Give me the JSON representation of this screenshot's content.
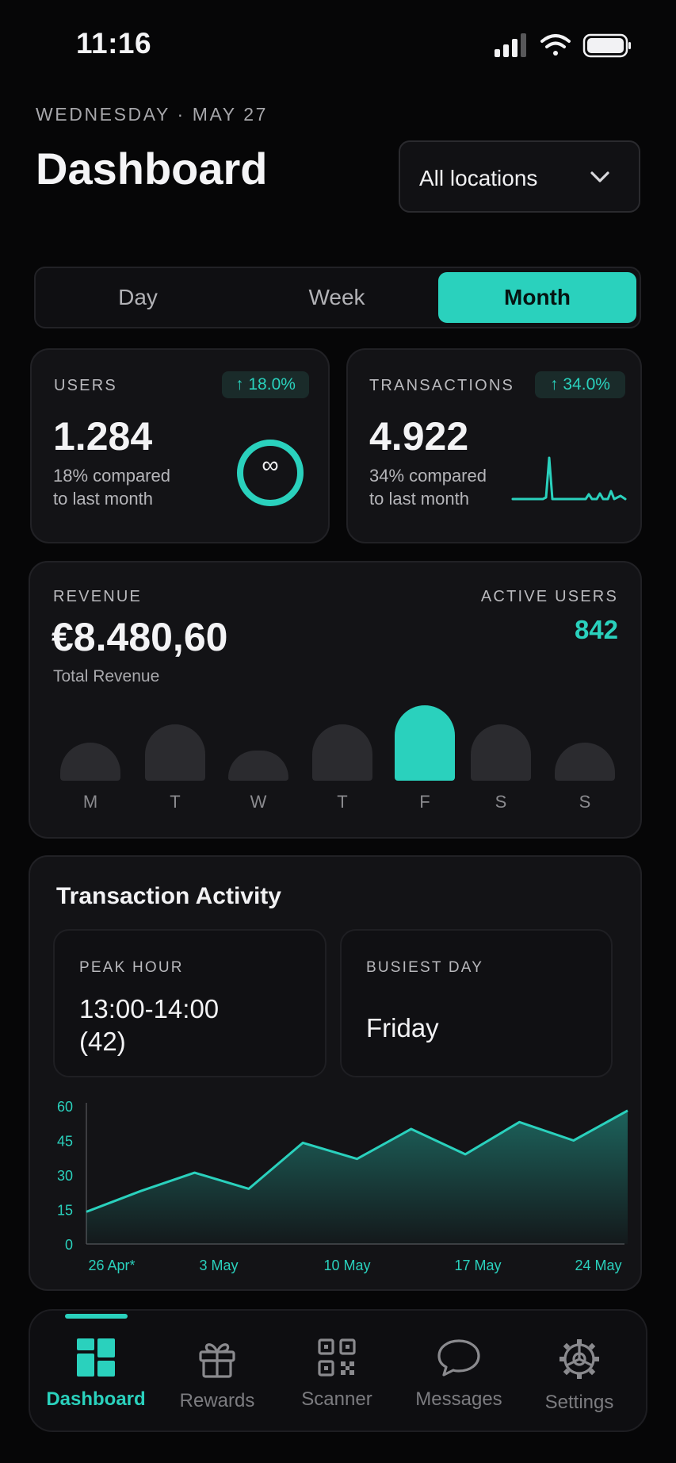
{
  "status_bar": {
    "time": "11:16"
  },
  "header": {
    "date": "WEDNESDAY · MAY 27",
    "title": "Dashboard",
    "location": "All locations"
  },
  "period_tabs": [
    {
      "label": "Day",
      "active": false
    },
    {
      "label": "Week",
      "active": false
    },
    {
      "label": "Month",
      "active": true
    }
  ],
  "users": {
    "label": "USERS",
    "change": "↑ 18.0%",
    "value": "1.284",
    "note_line1": "18% compared",
    "note_line2": "to last month",
    "ring_symbol": "∞"
  },
  "transactions": {
    "label": "TRANSACTIONS",
    "change": "↑ 34.0%",
    "value": "4.922",
    "note_line1": "34% compared",
    "note_line2": "to last month"
  },
  "revenue": {
    "label": "REVENUE",
    "value": "€8.480,60",
    "caption": "Total Revenue",
    "active_users_label": "ACTIVE USERS",
    "active_users_value": "842",
    "weekdays": [
      "M",
      "T",
      "W",
      "T",
      "F",
      "S",
      "S"
    ],
    "highlighted_day_index": 4
  },
  "activity": {
    "title": "Transaction Activity",
    "peak_hour_label": "PEAK HOUR",
    "peak_hour_line1": "13:00-14:00",
    "peak_hour_line2": "(42)",
    "busiest_day_label": "BUSIEST DAY",
    "busiest_day_value": "Friday"
  },
  "chart_data": {
    "type": "area",
    "y_ticks": [
      "60",
      "45",
      "30",
      "15",
      "0"
    ],
    "x_tick_labels": [
      "26 Apr*",
      "3 May",
      "10 May",
      "17 May",
      "24 May"
    ],
    "ylim": [
      0,
      60
    ],
    "series": [
      {
        "values": [
          14,
          23,
          31,
          24,
          44,
          37,
          50,
          39,
          53,
          45,
          58
        ]
      }
    ],
    "color": "#2ad1bd"
  },
  "nav": [
    {
      "label": "Dashboard",
      "icon": "dashboard-icon",
      "active": true
    },
    {
      "label": "Rewards",
      "icon": "gift-icon",
      "active": false
    },
    {
      "label": "Scanner",
      "icon": "qr-code-icon",
      "active": false
    },
    {
      "label": "Messages",
      "icon": "chat-bubble-icon",
      "active": false
    },
    {
      "label": "Settings",
      "icon": "gear-icon",
      "active": false
    }
  ],
  "colors": {
    "accent": "#2ad1bd",
    "background": "#060607",
    "card": "#131316"
  }
}
